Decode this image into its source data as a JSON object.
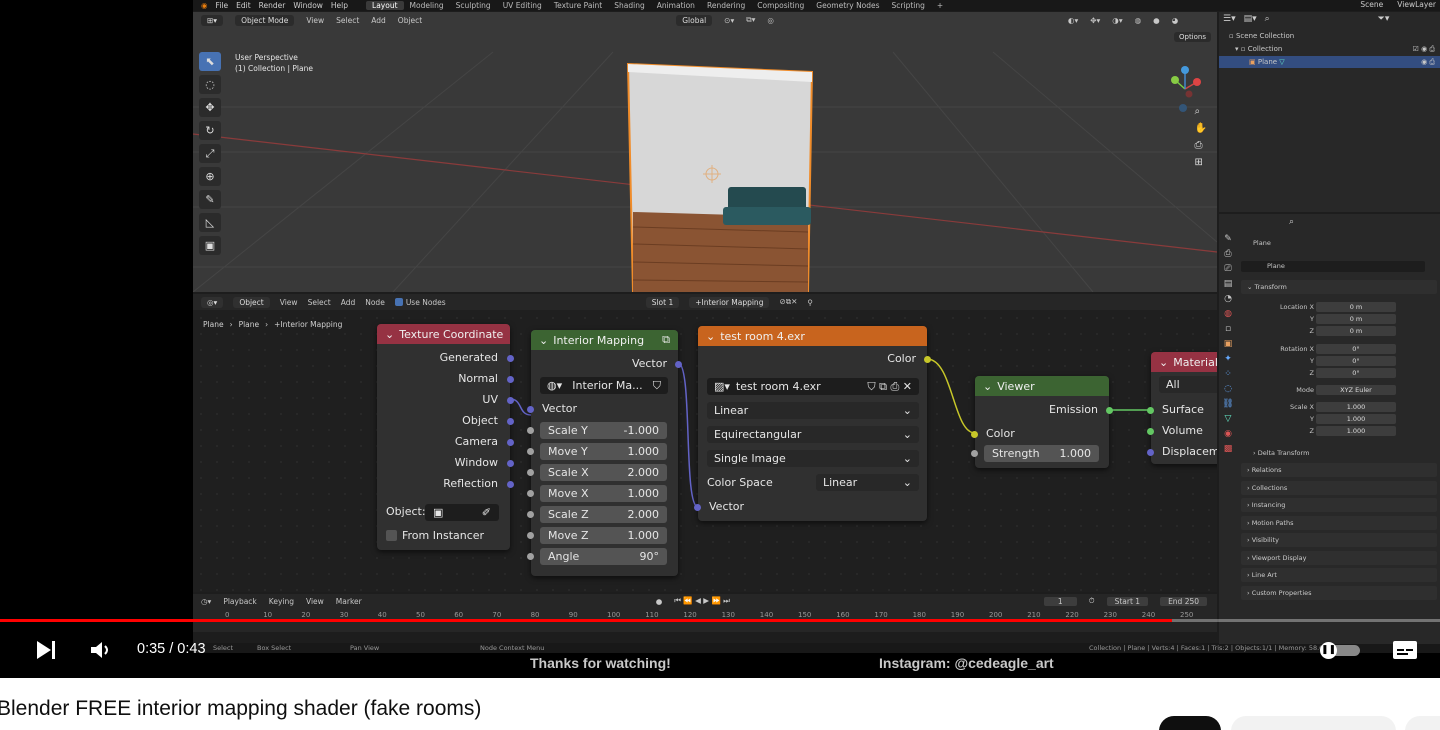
{
  "blender": {
    "menu": [
      "File",
      "Edit",
      "Render",
      "Window",
      "Help"
    ],
    "workspaces": [
      "Layout",
      "Modeling",
      "Sculpting",
      "UV Editing",
      "Texture Paint",
      "Shading",
      "Animation",
      "Rendering",
      "Compositing",
      "Geometry Nodes",
      "Scripting"
    ],
    "active_workspace": "Layout",
    "scene": "Scene",
    "view_layer": "ViewLayer",
    "viewport": {
      "mode": "Object Mode",
      "menus": [
        "View",
        "Select",
        "Add",
        "Object"
      ],
      "transform": "Global",
      "info_line1": "User Perspective",
      "info_line2": "(1) Collection | Plane",
      "options": "Options"
    },
    "node_editor": {
      "mode": "Object",
      "menus": [
        "View",
        "Select",
        "Add",
        "Node"
      ],
      "use_nodes": "Use Nodes",
      "slot": "Slot 1",
      "material": "+Interior Mapping",
      "breadcrumb": [
        "Plane",
        "Plane",
        "+Interior Mapping"
      ]
    },
    "nodes": {
      "texcoord": {
        "title": "Texture Coordinate",
        "outputs": [
          "Generated",
          "Normal",
          "UV",
          "Object",
          "Camera",
          "Window",
          "Reflection"
        ],
        "object_label": "Object:",
        "from_instancer": "From Instancer"
      },
      "interior": {
        "title": "Interior Mapping",
        "output": "Vector",
        "group_name": "Interior Ma...",
        "input": "Vector",
        "params": [
          {
            "label": "Scale Y",
            "value": "-1.000"
          },
          {
            "label": "Move Y",
            "value": "1.000"
          },
          {
            "label": "Scale X",
            "value": "2.000"
          },
          {
            "label": "Move X",
            "value": "1.000"
          },
          {
            "label": "Scale Z",
            "value": "2.000"
          },
          {
            "label": "Move Z",
            "value": "1.000"
          },
          {
            "label": "Angle",
            "value": "90°"
          }
        ]
      },
      "image": {
        "title": "test room 4.exr",
        "output": "Color",
        "image_name": "test room 4.exr",
        "interpolation": "Linear",
        "projection": "Equirectangular",
        "source": "Single Image",
        "color_space_label": "Color Space",
        "color_space": "Linear",
        "input": "Vector"
      },
      "viewer": {
        "title": "Viewer",
        "output": "Emission",
        "input": "Color",
        "strength_label": "Strength",
        "strength": "1.000"
      },
      "material": {
        "title": "Material",
        "target": "All",
        "inputs": [
          "Surface",
          "Volume",
          "Displaceme"
        ]
      }
    },
    "timeline": {
      "menus": [
        "Playback",
        "Keying",
        "View",
        "Marker"
      ],
      "current_frame": "1",
      "start_label": "Start",
      "start": "1",
      "end_label": "End",
      "end": "250",
      "ticks": [
        "0",
        "10",
        "20",
        "30",
        "40",
        "50",
        "60",
        "70",
        "80",
        "90",
        "100",
        "110",
        "120",
        "130",
        "140",
        "150",
        "160",
        "170",
        "180",
        "190",
        "200",
        "210",
        "220",
        "230",
        "240",
        "250"
      ]
    },
    "status_bar": {
      "left": [
        "Select",
        "Box Select",
        "Pan View",
        "Node Context Menu"
      ],
      "right": "Collection | Plane | Verts:4 | Faces:1 | Tris:2 | Objects:1/1 | Memory: 58.6"
    },
    "outliner": {
      "items": [
        "Scene Collection",
        "Collection",
        "Plane"
      ]
    },
    "properties": {
      "object": "Plane",
      "data_name": "Plane",
      "transform": "Transform",
      "location": [
        {
          "axis": "Location X",
          "value": "0 m"
        },
        {
          "axis": "Y",
          "value": "0 m"
        },
        {
          "axis": "Z",
          "value": "0 m"
        }
      ],
      "rotation": [
        {
          "axis": "Rotation X",
          "value": "0°"
        },
        {
          "axis": "Y",
          "value": "0°"
        },
        {
          "axis": "Z",
          "value": "0°"
        }
      ],
      "mode_label": "Mode",
      "mode": "XYZ Euler",
      "scale": [
        {
          "axis": "Scale X",
          "value": "1.000"
        },
        {
          "axis": "Y",
          "value": "1.000"
        },
        {
          "axis": "Z",
          "value": "1.000"
        }
      ],
      "delta": "Delta Transform",
      "panels": [
        "Relations",
        "Collections",
        "Instancing",
        "Motion Paths",
        "Visibility",
        "Viewport Display",
        "Line Art",
        "Custom Properties"
      ]
    }
  },
  "player": {
    "current_time": "0:35",
    "duration": "0:43",
    "time_display": "0:35 / 0:43",
    "progress": 0.814,
    "overlay_left": "Thanks for watching!",
    "overlay_right": "Instagram: @cedeagle_art"
  },
  "video_title": "Blender FREE interior mapping shader (fake rooms)",
  "colors": {
    "progress": "#ff0000",
    "texcoord_header": "#963243",
    "group_header": "#3c6432",
    "image_header": "#c8641e",
    "viewer_header": "#3c6432",
    "material_header": "#963243",
    "socket_vector": "#6363c7",
    "socket_color": "#c7c729",
    "socket_shader": "#63c763",
    "socket_value": "#a1a1a1"
  }
}
